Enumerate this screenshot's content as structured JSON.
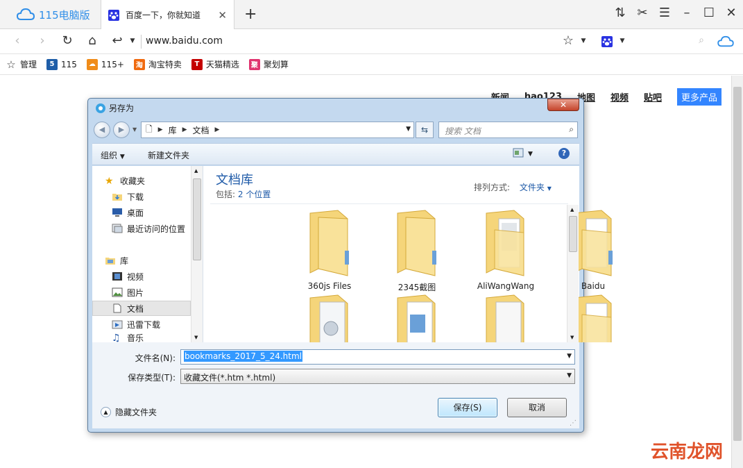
{
  "browser": {
    "brand": "115电脑版",
    "tab_title": "百度一下，你就知道",
    "url": "www.baidu.com"
  },
  "bookmarks": [
    {
      "label": "管理",
      "icon": "star-icon"
    },
    {
      "label": "115",
      "icon": "115-logo-icon",
      "icon_text": "5",
      "color": "#1f5ea8"
    },
    {
      "label": "115+",
      "icon": "cloud-plus-icon",
      "color": "#f08c19"
    },
    {
      "label": "淘宝特卖",
      "icon": "taobao-icon",
      "icon_text": "淘",
      "color": "#f06a0f"
    },
    {
      "label": "天猫精选",
      "icon": "tmall-icon",
      "icon_text": "T",
      "color": "#c40000"
    },
    {
      "label": "聚划算",
      "icon": "juhuasuan-icon",
      "icon_text": "聚",
      "color": "#e0336f"
    }
  ],
  "page": {
    "links": [
      "新闻",
      "hao123",
      "地图",
      "视频",
      "贴吧"
    ],
    "more_products": "更多产品",
    "watermark": "云南龙网"
  },
  "dialog": {
    "title": "另存为",
    "breadcrumb": [
      "库",
      "文档"
    ],
    "search_placeholder": "搜索 文档",
    "toolbar": {
      "organize": "组织",
      "new_folder": "新建文件夹"
    },
    "nav": {
      "favorites_header": "收藏夹",
      "favorites": [
        "下载",
        "桌面",
        "最近访问的位置"
      ],
      "libraries_header": "库",
      "libraries": [
        "视频",
        "图片",
        "文档",
        "迅雷下载",
        "音乐"
      ]
    },
    "library": {
      "title": "文档库",
      "includes_label": "包括:",
      "includes_value": "2 个位置",
      "arrange_label": "排列方式:",
      "arrange_value": "文件夹"
    },
    "folders": [
      "360js Files",
      "2345截图",
      "AliWangWang",
      "Baidu"
    ],
    "filename_label": "文件名(N):",
    "filename_value": "bookmarks_2017_5_24.html",
    "filetype_label": "保存类型(T):",
    "filetype_value": "收藏文件(*.htm *.html)",
    "hide_folders": "隐藏文件夹",
    "save_button": "保存(S)",
    "cancel_button": "取消"
  },
  "colors": {
    "accent": "#3385ff",
    "dialog_frame": "#c4d9ef",
    "folder": "#f5d57a",
    "close_red": "#c5432a"
  }
}
